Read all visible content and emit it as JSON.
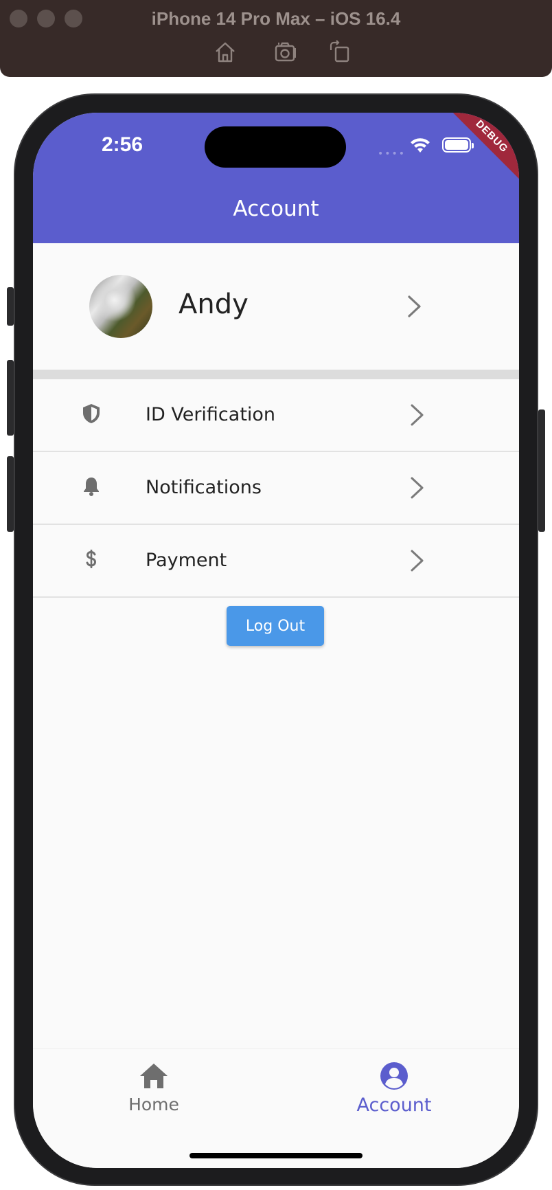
{
  "simulator": {
    "title": "iPhone 14 Pro Max – iOS 16.4",
    "toolbar_icons": [
      "home-icon",
      "screenshot-icon",
      "rotate-icon"
    ]
  },
  "status_bar": {
    "time": "2:56",
    "signal_dots": "••••",
    "icons": [
      "wifi-icon",
      "battery-icon"
    ]
  },
  "debug_banner": "DEBUG",
  "app_bar": {
    "title": "Account"
  },
  "profile": {
    "name": "Andy",
    "avatar": "waterfall-photo"
  },
  "menu": {
    "items": [
      {
        "label": "ID Verification",
        "icon": "shield-icon"
      },
      {
        "label": "Notifications",
        "icon": "bell-icon"
      },
      {
        "label": "Payment",
        "icon": "dollar-icon"
      }
    ]
  },
  "actions": {
    "logout_label": "Log Out"
  },
  "bottom_nav": {
    "items": [
      {
        "label": "Home",
        "icon": "home-icon",
        "active": false
      },
      {
        "label": "Account",
        "icon": "account-icon",
        "active": true
      }
    ]
  },
  "colors": {
    "primary": "#5b5dcd",
    "button": "#4a98e8",
    "inactive": "#6e6e6e",
    "debug": "#a0283c"
  }
}
